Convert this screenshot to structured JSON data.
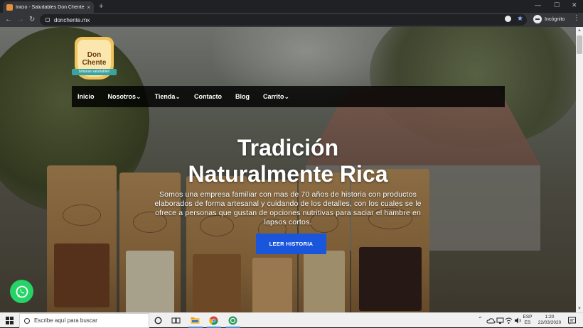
{
  "browser": {
    "tab_title": "Inicio - Saludables Don Chente",
    "tab_close": "×",
    "new_tab": "+",
    "url": "donchente.mx",
    "profile_label": "Incógnito",
    "menu": "⋮",
    "back": "←",
    "forward": "→",
    "reload": "↻",
    "minimize": "—",
    "maximize": "☐",
    "close": "✕"
  },
  "site": {
    "logo": {
      "line1": "Don",
      "line2": "Chente",
      "tagline": "botanas saludables"
    },
    "nav": [
      "Inicio",
      "Nosotros",
      "Tienda",
      "Contacto",
      "Blog",
      "Carrito"
    ],
    "hero": {
      "title_line1": "Tradición",
      "title_line2": "Naturalmente Rica",
      "text": "Somos una empresa familiar con mas de 70 años de historia con productos elaborados de forma artesanal y cuidando de los detalles, con los cuales se le ofrece a personas que gustan de opciones nutritivas para saciar el hambre en lapsos cortos.",
      "cta": "LEER HISTORIA"
    }
  },
  "taskbar": {
    "search_placeholder": "Escribe aquí para buscar",
    "lang_top": "ESP",
    "lang_bottom": "ES",
    "time": "1:20",
    "date": "22/03/2020"
  },
  "colors": {
    "cta": "#1a56db",
    "nav_bg": "#000000",
    "whatsapp": "#25d366",
    "chrome_bg": "#202124",
    "toolbar_bg": "#35363a"
  }
}
